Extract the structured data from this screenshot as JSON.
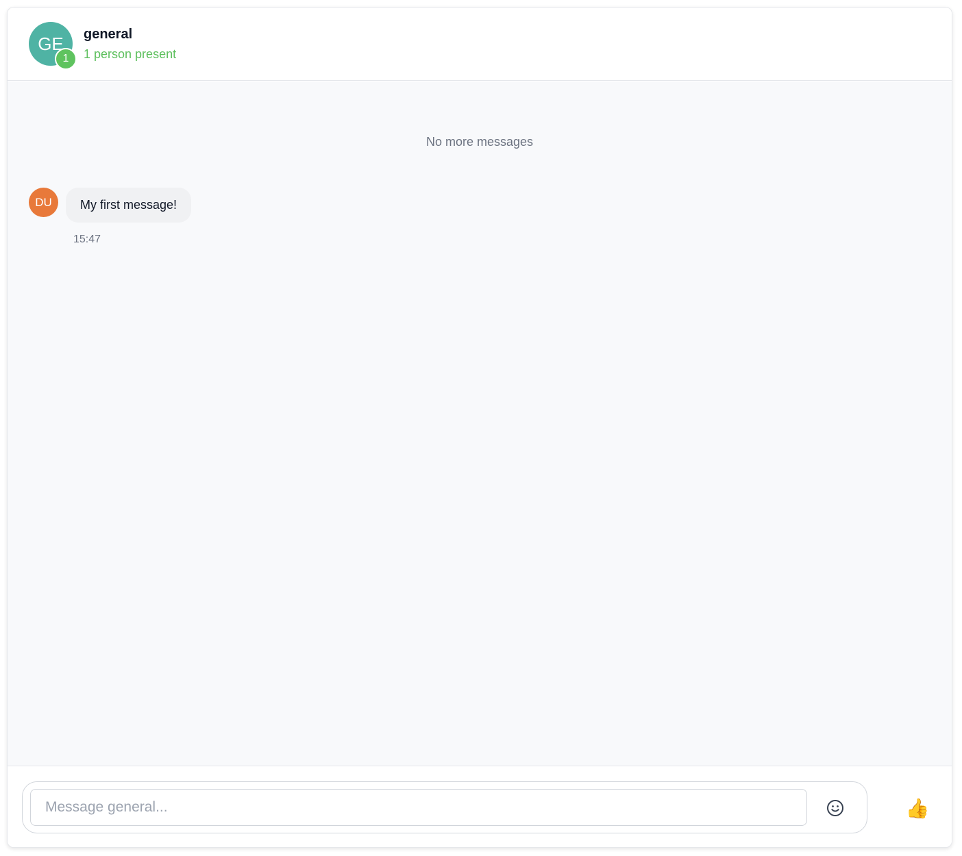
{
  "room": {
    "initials": "GE",
    "name": "general",
    "presence_count": "1",
    "presence_text": "1 person present"
  },
  "messages": {
    "no_more_label": "No more messages",
    "items": [
      {
        "author_initials": "DU",
        "text": "My first message!",
        "time": "15:47"
      }
    ]
  },
  "composer": {
    "placeholder": "Message general...",
    "value": "",
    "emoji_icon": "smiley-icon",
    "like_icon": "thumbs-up-icon",
    "like_glyph": "👍"
  },
  "colors": {
    "room_avatar": "#4fb3a4",
    "presence_green": "#5fc35f",
    "user_avatar": "#e8793a",
    "messages_bg": "#f8f9fb"
  }
}
